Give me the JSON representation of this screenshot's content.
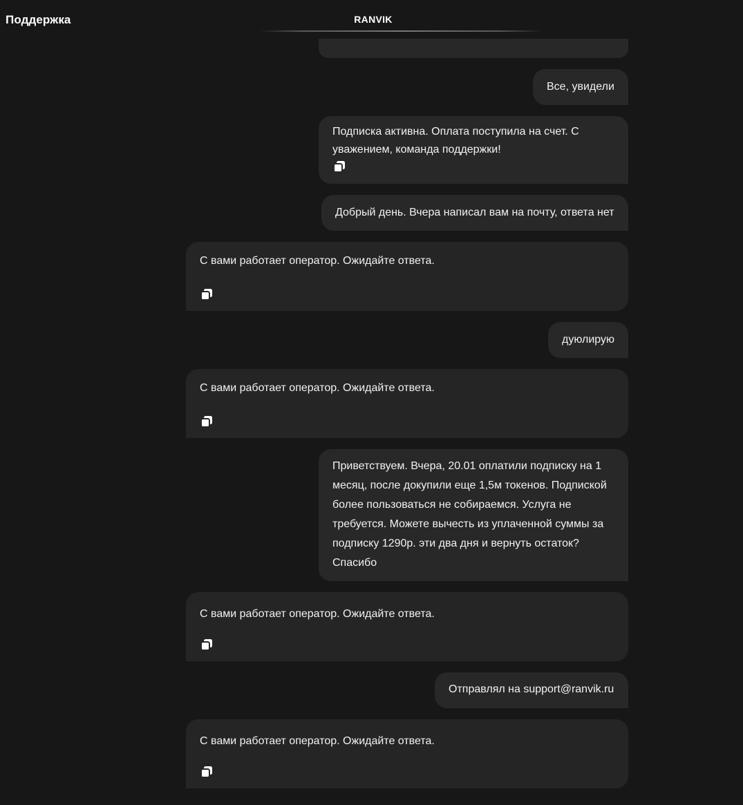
{
  "header": {
    "page_title": "Поддержка",
    "brand": "RANVIK"
  },
  "messages": [
    {
      "sender": "user",
      "text": "Все, увидели"
    },
    {
      "sender": "support",
      "text": "Подписка активна. Оплата поступила на счет. С уважением, команда поддержки!",
      "icon": "copy-icon"
    },
    {
      "sender": "user",
      "text": "Добрый день. Вчера написал вам на почту, ответа нет"
    },
    {
      "sender": "bot",
      "text": "С вами работает оператор. Ожидайте ответа.",
      "icon": "copy-icon"
    },
    {
      "sender": "user",
      "text": "дуюлирую"
    },
    {
      "sender": "bot",
      "text": "С вами работает оператор. Ожидайте ответа.",
      "icon": "copy-icon"
    },
    {
      "sender": "user",
      "text": "Приветствуем. Вчера, 20.01 оплатили подписку на 1 месяц, после докупили еще 1,5м токенов. Подпиской более пользоваться не собираемся. Услуга не требуется. Можете вычесть из уплаченной суммы за подписку 1290р. эти два дня и вернуть остаток? Спасибо"
    },
    {
      "sender": "bot",
      "text": "С вами работает оператор. Ожидайте ответа.",
      "icon": "copy-icon"
    },
    {
      "sender": "user",
      "text": "Отправлял на support@ranvik.ru"
    },
    {
      "sender": "bot",
      "text": "С вами работает оператор. Ожидайте ответа.",
      "icon": "copy-icon"
    }
  ]
}
